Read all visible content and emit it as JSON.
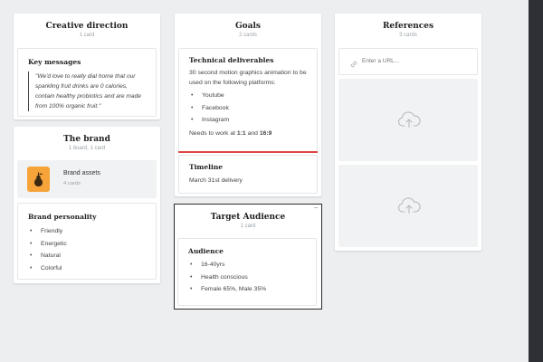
{
  "columns": {
    "creative": {
      "title": "Creative direction",
      "subtitle": "1 card"
    },
    "brand": {
      "title": "The brand",
      "subtitle": "1 board, 1 card"
    },
    "goals": {
      "title": "Goals",
      "subtitle": "2 cards"
    },
    "audience": {
      "title": "Target Audience",
      "subtitle": "1 card"
    },
    "references": {
      "title": "References",
      "subtitle": "3 cards"
    }
  },
  "key_messages": {
    "title": "Key messages",
    "quote": "\"We'd love to really dial home that our sparkling fruit drinks are 0 calories, contain healthy probiotics and are made from 100% organic fruit.\""
  },
  "brand_assets": {
    "title": "Brand assets",
    "subtitle": "4 cards"
  },
  "brand_personality": {
    "title": "Brand personality",
    "items": [
      "Friendly",
      "Energetic",
      "Natural",
      "Colorful"
    ]
  },
  "technical": {
    "title": "Technical deliverables",
    "intro": "30 second motion graphics animation to be used on the following platforms:",
    "platforms": [
      "Youtube",
      "Facebook",
      "Instagram"
    ],
    "note_prefix": "Needs to work at ",
    "ratio1": "1:1",
    "note_mid": " and ",
    "ratio2": "16:9"
  },
  "timeline": {
    "title": "Timeline",
    "text": "March 31st delivery"
  },
  "audience_card": {
    "title": "Audience",
    "items": [
      "16-40yrs",
      "Health conscious",
      "Female 65%, Male 35%"
    ]
  },
  "url_input": {
    "placeholder": "Enter a URL..."
  },
  "colors": {
    "accent_red": "#e04545",
    "asset_orange": "#f6a43a"
  },
  "icons": [
    "link-icon",
    "cloud-upload-icon",
    "pear-icon"
  ]
}
